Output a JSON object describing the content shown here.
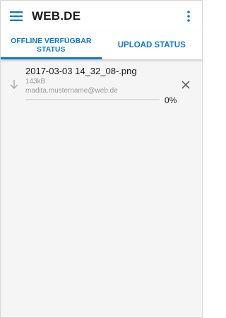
{
  "app": {
    "title": "WEB.DE",
    "accent_color": "#1279c4",
    "menu_icon": "hamburger-menu-icon",
    "overflow_icon": "more-vert-icon"
  },
  "tabs": [
    {
      "label": "OFFLINE VERFÜGBAR STATUS",
      "active": true
    },
    {
      "label": "UPLOAD STATUS",
      "active": false
    }
  ],
  "downloads": [
    {
      "file_name": "2017-03-03 14_32_08-.png",
      "size": "143kB",
      "account": "madita.mustername@web.de",
      "progress_fraction": 0,
      "progress_label": "0%",
      "status_icon": "download-arrow-icon",
      "cancel_icon": "close-icon"
    }
  ]
}
